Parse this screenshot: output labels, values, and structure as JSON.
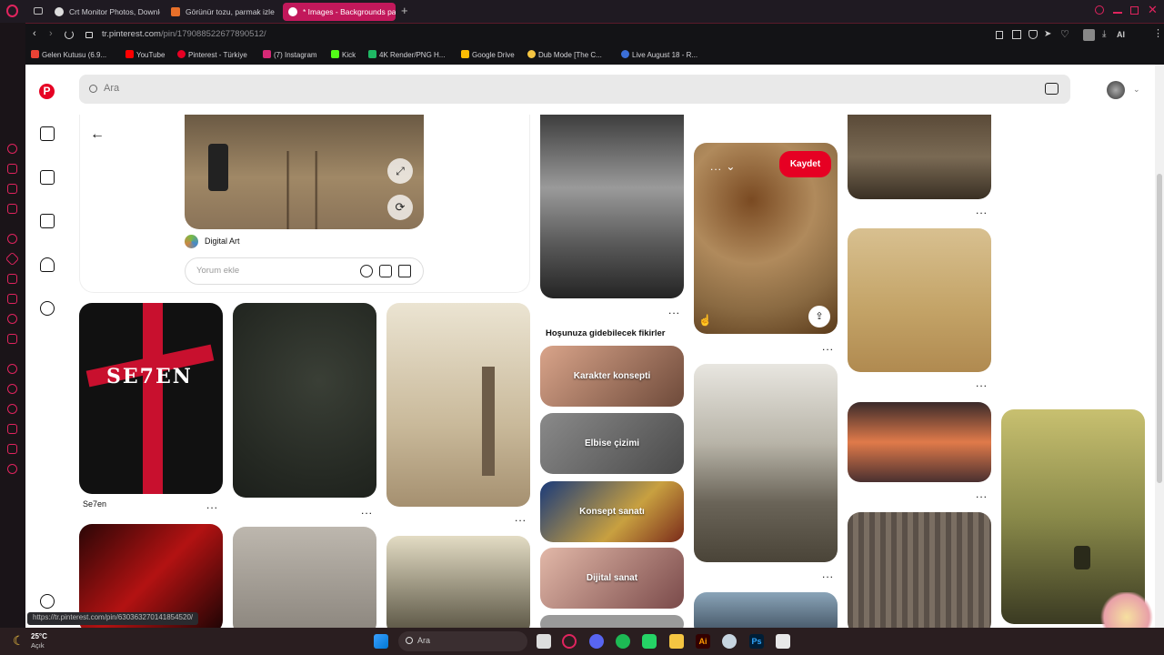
{
  "browser": {
    "tabs": [
      {
        "label": "Crt Monitor Photos, Downlo",
        "active": false
      },
      {
        "label": "Görünür tozu, parmak izleri",
        "active": false
      },
      {
        "label": "* Images - Backgrounds pa",
        "active": true
      }
    ],
    "url_host": "tr.pinterest.com",
    "url_path": "/pin/179088522677890512/",
    "bookmarks": [
      "Gelen Kutusu (6.9...",
      "YouTube",
      "Pinterest - Türkiye",
      "(7) Instagram",
      "Kick",
      "4K Render/PNG H...",
      "Google Drive",
      "Dub Mode [The C...",
      "Live August 18 - R..."
    ],
    "status_url": "https://tr.pinterest.com/pin/630363270141854520/"
  },
  "pinterest": {
    "search_placeholder": "Ara",
    "pin_source": "Digital Art",
    "comment_placeholder": "Yorum ekle",
    "save_button": "Kaydet",
    "more_ideas_heading": "Hoşunuza gidebilecek fikirler",
    "ideas": [
      "Karakter konsepti",
      "Elbise çizimi",
      "Konsept sanatı",
      "Dijital sanat"
    ],
    "pin_titles": {
      "seven": "Se7en"
    },
    "seven_poster_text": "SE7EN",
    "menu_dots": "...",
    "dropdown_dots": "..."
  },
  "taskbar": {
    "weather_temp": "25°C",
    "weather_desc": "Açık",
    "search_label": "Ara"
  },
  "colors": {
    "brand": "#e60023",
    "browser_accent": "#c2185b"
  }
}
